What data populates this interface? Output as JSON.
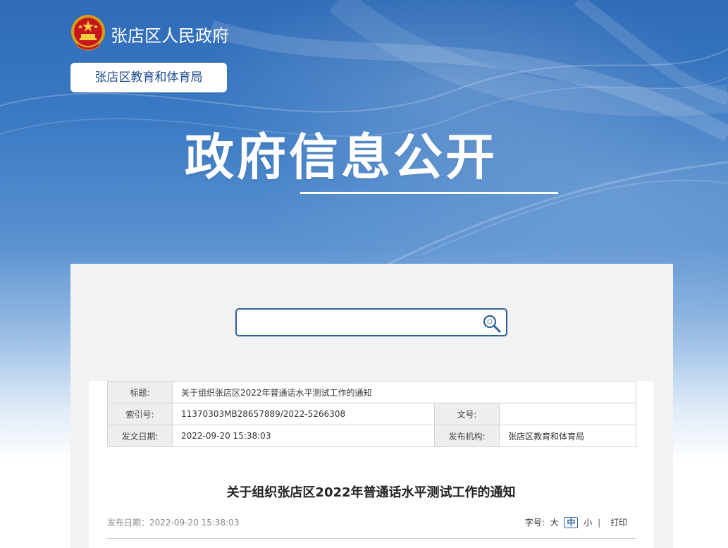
{
  "header": {
    "site_name": "张店区人民政府",
    "dept_button": "张店区教育和体育局",
    "hero_title": "政府信息公开"
  },
  "search": {
    "value": "",
    "placeholder": ""
  },
  "meta_table": {
    "title_label": "标题:",
    "title_value": "关于组织张店区2022年普通话水平测试工作的通知",
    "index_label": "索引号:",
    "index_value": "11370303MB28657889/2022-5266308",
    "docno_label": "文号:",
    "docno_value": "",
    "date_label": "发文日期:",
    "date_value": "2022-09-20 15:38:03",
    "org_label": "发布机构:",
    "org_value": "张店区教育和体育局"
  },
  "article": {
    "title": "关于组织张店区2022年普通话水平测试工作的通知",
    "pub_date": "发布日期：2022-09-20 15:38:03",
    "font_size_label": "字号:",
    "size_large": "大",
    "size_medium": "中",
    "size_small": "小",
    "separator": "|",
    "print": "打印"
  },
  "colors": {
    "brand_blue": "#2f6bb7",
    "border_blue": "#2f5f9e"
  },
  "icons": {
    "emblem": "national-emblem-icon",
    "search": "search-icon"
  }
}
